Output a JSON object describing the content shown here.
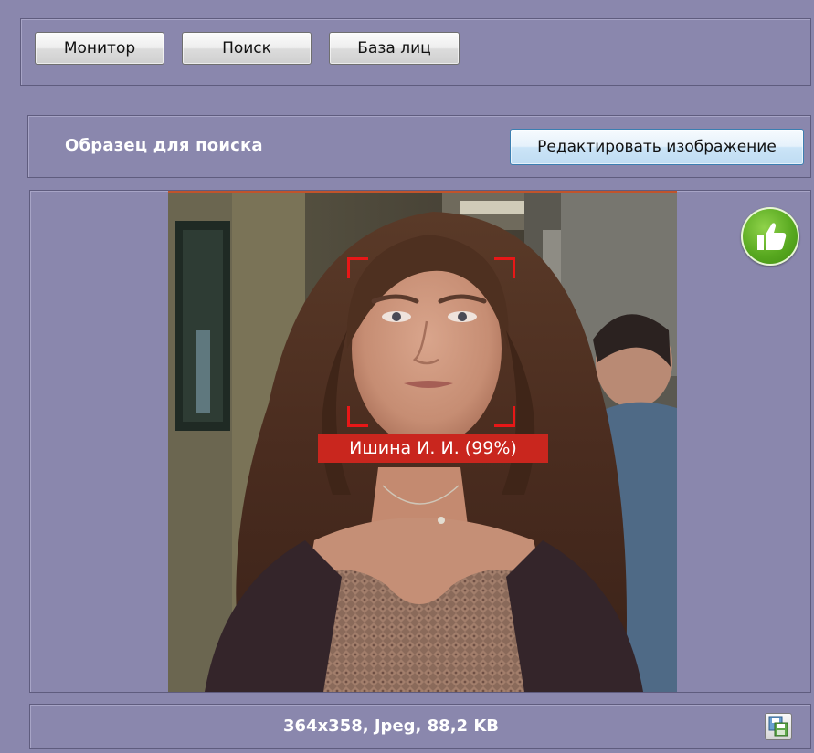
{
  "tabs": {
    "monitor": "Монитор",
    "search": "Поиск",
    "faces": "База лиц"
  },
  "sample": {
    "title": "Образец для поиска",
    "edit_button": "Редактировать изображение"
  },
  "detection": {
    "label": "Ишина И. И. (99%)",
    "box_color": "#e81717",
    "label_bg": "#c9261e"
  },
  "status_icon": "thumbs-up-icon",
  "image_info": "364x358, Jpeg, 88,2 KB",
  "save_icon": "save-image-icon",
  "colors": {
    "background": "#8a87ad",
    "panel_border": "#5f5c7e",
    "badge_green": "#57a81f"
  }
}
